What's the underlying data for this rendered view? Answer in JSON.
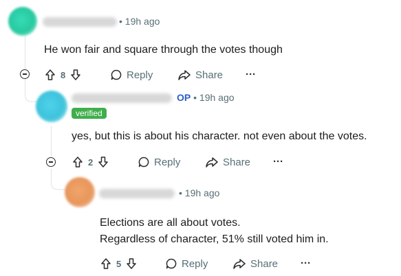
{
  "comments": [
    {
      "meta": "• 19h ago",
      "body": "He won fair and square through the votes though",
      "votes": "8",
      "reply_label": "Reply",
      "share_label": "Share",
      "more_label": "···"
    },
    {
      "op_label": "OP",
      "meta": "• 19h ago",
      "flair": "verified",
      "body": "yes, but this is about his character. not even about the votes.",
      "votes": "2",
      "reply_label": "Reply",
      "share_label": "Share",
      "more_label": "···"
    },
    {
      "meta": "• 19h ago",
      "body_lines": [
        "Elections are all about votes.",
        "Regardless of character, 51% still voted him in."
      ],
      "votes": "5",
      "reply_label": "Reply",
      "share_label": "Share",
      "more_label": "···"
    }
  ],
  "colors": {
    "avatar1": "#2fd1a8",
    "avatar2": "#3ec3dc",
    "avatar3": "#e8965c",
    "op": "#2b5ec8",
    "flair": "#3fae4c",
    "meta": "#576f76"
  }
}
